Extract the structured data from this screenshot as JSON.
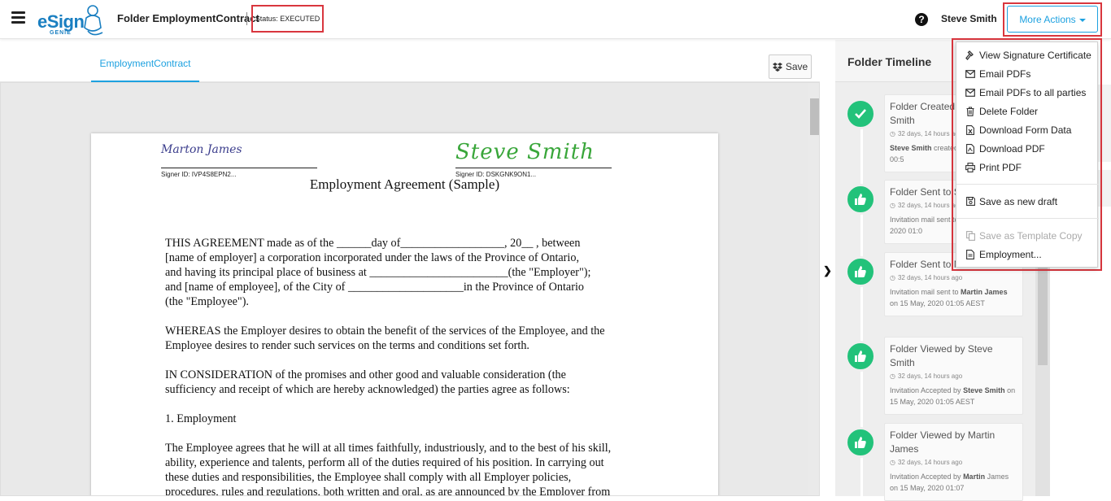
{
  "app": {
    "logo_text": "eSign",
    "logo_sub": "GENIE",
    "folder_title": "Folder EmploymentContract",
    "status": "Status: EXECUTED",
    "user_name": "Steve Smith",
    "more_actions_label": "More Actions"
  },
  "document": {
    "tab_label": "EmploymentContract",
    "save_label": "Save",
    "signer1_signature": "Marton James",
    "signer1_id": "Signer ID: IVP4S8EPN2...",
    "signer2_signature": "Steve Smith",
    "signer2_id": "Signer ID: DSKGNK9ON1...",
    "heading": "Employment Agreement (Sample)",
    "paragraphs": [
      "THIS AGREEMENT made as of the ______day of__________________, 20__ , between\n[name of employer] a corporation incorporated under the laws of the Province of Ontario,\nand having its principal place of business at ________________________(the \"Employer\");\nand [name of employee], of the City of ____________________in the Province of Ontario\n(the \"Employee\").",
      "WHEREAS the Employer desires to obtain the benefit of the services of the Employee, and the\nEmployee desires to render such services on the terms and conditions set forth.",
      "IN CONSIDERATION of the promises and other good and valuable consideration (the\nsufficiency and receipt of which are hereby acknowledged) the parties agree as follows:",
      "1. Employment",
      "The Employee agrees that he will at all times faithfully, industriously, and to the best of his skill,\nability, experience and talents, perform all of the duties required of his position. In carrying out\nthese duties and responsibilities, the Employee shall comply with all Employer policies,\nprocedures, rules and regulations, both written and oral, as are announced by the Employer from"
    ]
  },
  "timeline": {
    "title": "Folder Timeline",
    "items": [
      {
        "icon": "check-icon",
        "event": "Folder Created by Steve Smith",
        "time": "32 days, 14 hours ago",
        "desc_bold": "Steve Smith",
        "desc_rest": " created on 15 May, 2020 00:5"
      },
      {
        "icon": "thumbs-up-icon",
        "event": "Folder Sent to Steve",
        "time": "32 days, 14 hours ago",
        "desc_bold": "",
        "desc_rest": "Invitation mail sent to S on 15 May, 2020 01:0"
      },
      {
        "icon": "thumbs-up-icon",
        "event": "Folder Sent to Martin James",
        "time": "32 days, 14 hours ago",
        "desc_pre": "Invitation mail sent to ",
        "desc_bold": "Martin James",
        "desc_rest": " on 15 May, 2020 01:05 AEST"
      },
      {
        "icon": "thumbs-up-icon",
        "event": "Folder Viewed by Steve Smith",
        "time": "32 days, 14 hours ago",
        "desc_pre": "Invitation Accepted by ",
        "desc_bold": "Steve Smith",
        "desc_rest": " on 15 May, 2020 01:05 AEST"
      },
      {
        "icon": "thumbs-up-icon",
        "event": "Folder Viewed by Martin James",
        "time": "32 days, 14 hours ago",
        "desc_pre": "Invitation Accepted by ",
        "desc_bold": "Martin",
        "desc_rest": " James on 15 May, 2020 01:07"
      }
    ]
  },
  "menu": {
    "items": [
      {
        "label": "View Signature Certificate",
        "icon": "gavel-icon",
        "disabled": false
      },
      {
        "label": "Email PDFs",
        "icon": "envelope-icon",
        "disabled": false
      },
      {
        "label": "Email PDFs to all parties",
        "icon": "envelope-icon",
        "disabled": false
      },
      {
        "label": "Delete Folder",
        "icon": "trash-icon",
        "disabled": false
      },
      {
        "label": "Download Form Data",
        "icon": "file-excel-icon",
        "disabled": false
      },
      {
        "label": "Download PDF",
        "icon": "file-pdf-icon",
        "disabled": false
      },
      {
        "label": "Print PDF",
        "icon": "print-icon",
        "disabled": false
      },
      {
        "label": "Save as new draft",
        "icon": "save-icon",
        "disabled": false
      },
      {
        "label": "Save as Template Copy",
        "icon": "copy-icon",
        "disabled": true
      },
      {
        "label": "Employment...",
        "icon": "file-icon",
        "disabled": false
      }
    ]
  },
  "colors": {
    "accent": "#1da1e0",
    "highlight": "#d9363e",
    "timeline_green": "#22c27a",
    "signature2": "#39a63a",
    "signature1": "#3b3d8c"
  }
}
